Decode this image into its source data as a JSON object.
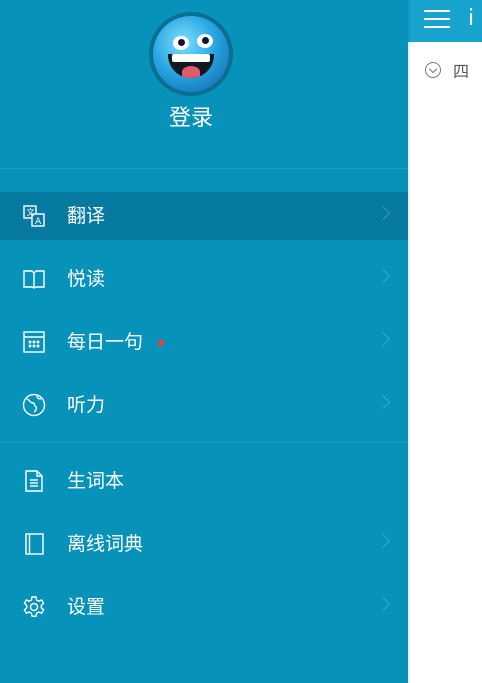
{
  "header": {
    "login_label": "登录"
  },
  "main": {
    "title": "i",
    "sub_label": "四"
  },
  "menu": [
    {
      "label": "翻译",
      "icon": "translate-icon",
      "active": true
    },
    {
      "label": "悦读",
      "icon": "book-icon"
    },
    {
      "label": "每日一句",
      "icon": "calendar-icon",
      "badge": "red-dot"
    },
    {
      "label": "听力",
      "icon": "globe-icon"
    },
    {
      "label": "生词本",
      "icon": "notebook-icon"
    },
    {
      "label": "离线词典",
      "icon": "dictionary-icon"
    },
    {
      "label": "设置",
      "icon": "gear-icon"
    }
  ],
  "colors": {
    "drawer_bg": "#0792ba",
    "active_bg": "#067aa0",
    "topbar_bg": "#18a3cf",
    "badge": "#ff3b30"
  }
}
